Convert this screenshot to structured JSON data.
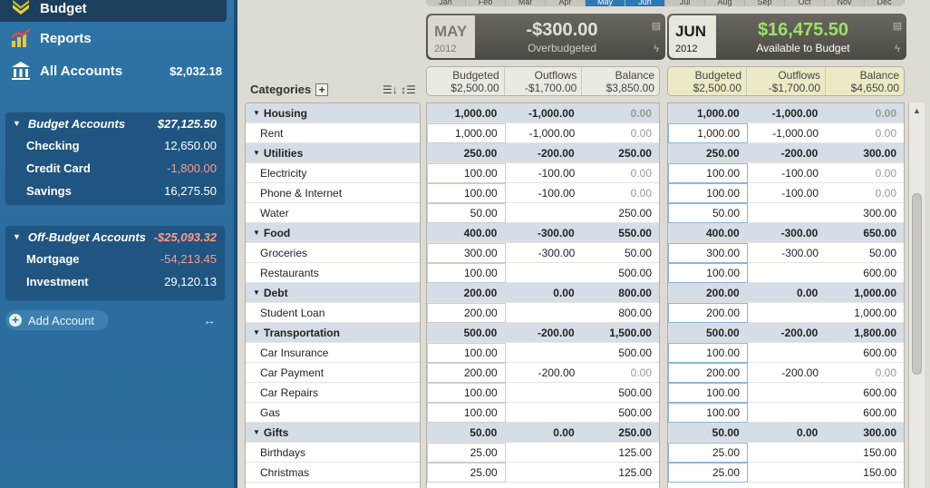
{
  "sidebar": {
    "nav": [
      {
        "label": "Budget",
        "icon": "budget-icon"
      },
      {
        "label": "Reports",
        "icon": "reports-chart-icon"
      },
      {
        "label": "All Accounts",
        "icon": "bank-icon",
        "amount": "$2,032.18"
      }
    ],
    "budget_group": {
      "title": "Budget Accounts",
      "amount": "$27,125.50",
      "accounts": [
        {
          "name": "Checking",
          "amount": "12,650.00",
          "negative": false
        },
        {
          "name": "Credit Card",
          "amount": "-1,800.00",
          "negative": true
        },
        {
          "name": "Savings",
          "amount": "16,275.50",
          "negative": false
        }
      ]
    },
    "offbudget_group": {
      "title": "Off-Budget Accounts",
      "amount": "-$25,093.32",
      "accounts": [
        {
          "name": "Mortgage",
          "amount": "-54,213.45",
          "negative": true
        },
        {
          "name": "Investment",
          "amount": "29,120.13",
          "negative": false
        }
      ]
    },
    "add_account": "Add Account"
  },
  "month_strip": {
    "year": "2012",
    "months": [
      "Jan",
      "Feb",
      "Mar",
      "Apr",
      "May",
      "Jun",
      "Jul",
      "Aug",
      "Sep",
      "Oct",
      "Nov",
      "Dec"
    ],
    "selected": [
      "May",
      "Jun"
    ]
  },
  "months": [
    {
      "month": "MAY",
      "year": "2012",
      "amount": "-$300.00",
      "label": "Overbudgeted",
      "totals": {
        "budgeted_label": "Budgeted",
        "budgeted": "$2,500.00",
        "outflows_label": "Outflows",
        "outflows": "-$1,700.00",
        "balance_label": "Balance",
        "balance": "$3,850.00"
      }
    },
    {
      "month": "JUN",
      "year": "2012",
      "amount": "$16,475.50",
      "label": "Available to Budget",
      "totals": {
        "budgeted_label": "Budgeted",
        "budgeted": "$2,500.00",
        "outflows_label": "Outflows",
        "outflows": "-$1,700.00",
        "balance_label": "Balance",
        "balance": "$4,650.00"
      }
    }
  ],
  "categories_header": "Categories",
  "rows": [
    {
      "name": "Housing",
      "master": true,
      "may": [
        "1,000.00",
        "-1,000.00",
        "0.00"
      ],
      "jun": [
        "1,000.00",
        "-1,000.00",
        "0.00"
      ]
    },
    {
      "name": "Rent",
      "master": false,
      "may": [
        "1,000.00",
        "-1,000.00",
        "0.00"
      ],
      "jun": [
        "1,000.00",
        "-1,000.00",
        "0.00"
      ]
    },
    {
      "name": "Utilities",
      "master": true,
      "may": [
        "250.00",
        "-200.00",
        "250.00"
      ],
      "jun": [
        "250.00",
        "-200.00",
        "300.00"
      ]
    },
    {
      "name": "Electricity",
      "master": false,
      "may": [
        "100.00",
        "-100.00",
        "0.00"
      ],
      "jun": [
        "100.00",
        "-100.00",
        "0.00"
      ]
    },
    {
      "name": "Phone & Internet",
      "master": false,
      "may": [
        "100.00",
        "-100.00",
        "0.00"
      ],
      "jun": [
        "100.00",
        "-100.00",
        "0.00"
      ]
    },
    {
      "name": "Water",
      "master": false,
      "may": [
        "50.00",
        "",
        "250.00"
      ],
      "jun": [
        "50.00",
        "",
        "300.00"
      ]
    },
    {
      "name": "Food",
      "master": true,
      "may": [
        "400.00",
        "-300.00",
        "550.00"
      ],
      "jun": [
        "400.00",
        "-300.00",
        "650.00"
      ]
    },
    {
      "name": "Groceries",
      "master": false,
      "may": [
        "300.00",
        "-300.00",
        "50.00"
      ],
      "jun": [
        "300.00",
        "-300.00",
        "50.00"
      ]
    },
    {
      "name": "Restaurants",
      "master": false,
      "may": [
        "100.00",
        "",
        "500.00"
      ],
      "jun": [
        "100.00",
        "",
        "600.00"
      ]
    },
    {
      "name": "Debt",
      "master": true,
      "may": [
        "200.00",
        "0.00",
        "800.00"
      ],
      "jun": [
        "200.00",
        "0.00",
        "1,000.00"
      ]
    },
    {
      "name": "Student Loan",
      "master": false,
      "may": [
        "200.00",
        "",
        "800.00"
      ],
      "jun": [
        "200.00",
        "",
        "1,000.00"
      ]
    },
    {
      "name": "Transportation",
      "master": true,
      "may": [
        "500.00",
        "-200.00",
        "1,500.00"
      ],
      "jun": [
        "500.00",
        "-200.00",
        "1,800.00"
      ]
    },
    {
      "name": "Car Insurance",
      "master": false,
      "may": [
        "100.00",
        "",
        "500.00"
      ],
      "jun": [
        "100.00",
        "",
        "600.00"
      ]
    },
    {
      "name": "Car Payment",
      "master": false,
      "may": [
        "200.00",
        "-200.00",
        "0.00"
      ],
      "jun": [
        "200.00",
        "-200.00",
        "0.00"
      ]
    },
    {
      "name": "Car Repairs",
      "master": false,
      "may": [
        "100.00",
        "",
        "500.00"
      ],
      "jun": [
        "100.00",
        "",
        "600.00"
      ]
    },
    {
      "name": "Gas",
      "master": false,
      "may": [
        "100.00",
        "",
        "500.00"
      ],
      "jun": [
        "100.00",
        "",
        "600.00"
      ]
    },
    {
      "name": "Gifts",
      "master": true,
      "may": [
        "50.00",
        "0.00",
        "250.00"
      ],
      "jun": [
        "50.00",
        "0.00",
        "300.00"
      ]
    },
    {
      "name": "Birthdays",
      "master": false,
      "may": [
        "25.00",
        "",
        "125.00"
      ],
      "jun": [
        "25.00",
        "",
        "150.00"
      ]
    },
    {
      "name": "Christmas",
      "master": false,
      "may": [
        "25.00",
        "",
        "125.00"
      ],
      "jun": [
        "25.00",
        "",
        "150.00"
      ]
    }
  ],
  "colors": {
    "sidebar": "#2e74a6",
    "available_green": "#9ee06a",
    "negative": "#ff9a8c",
    "master_row": "#d5dde6"
  }
}
